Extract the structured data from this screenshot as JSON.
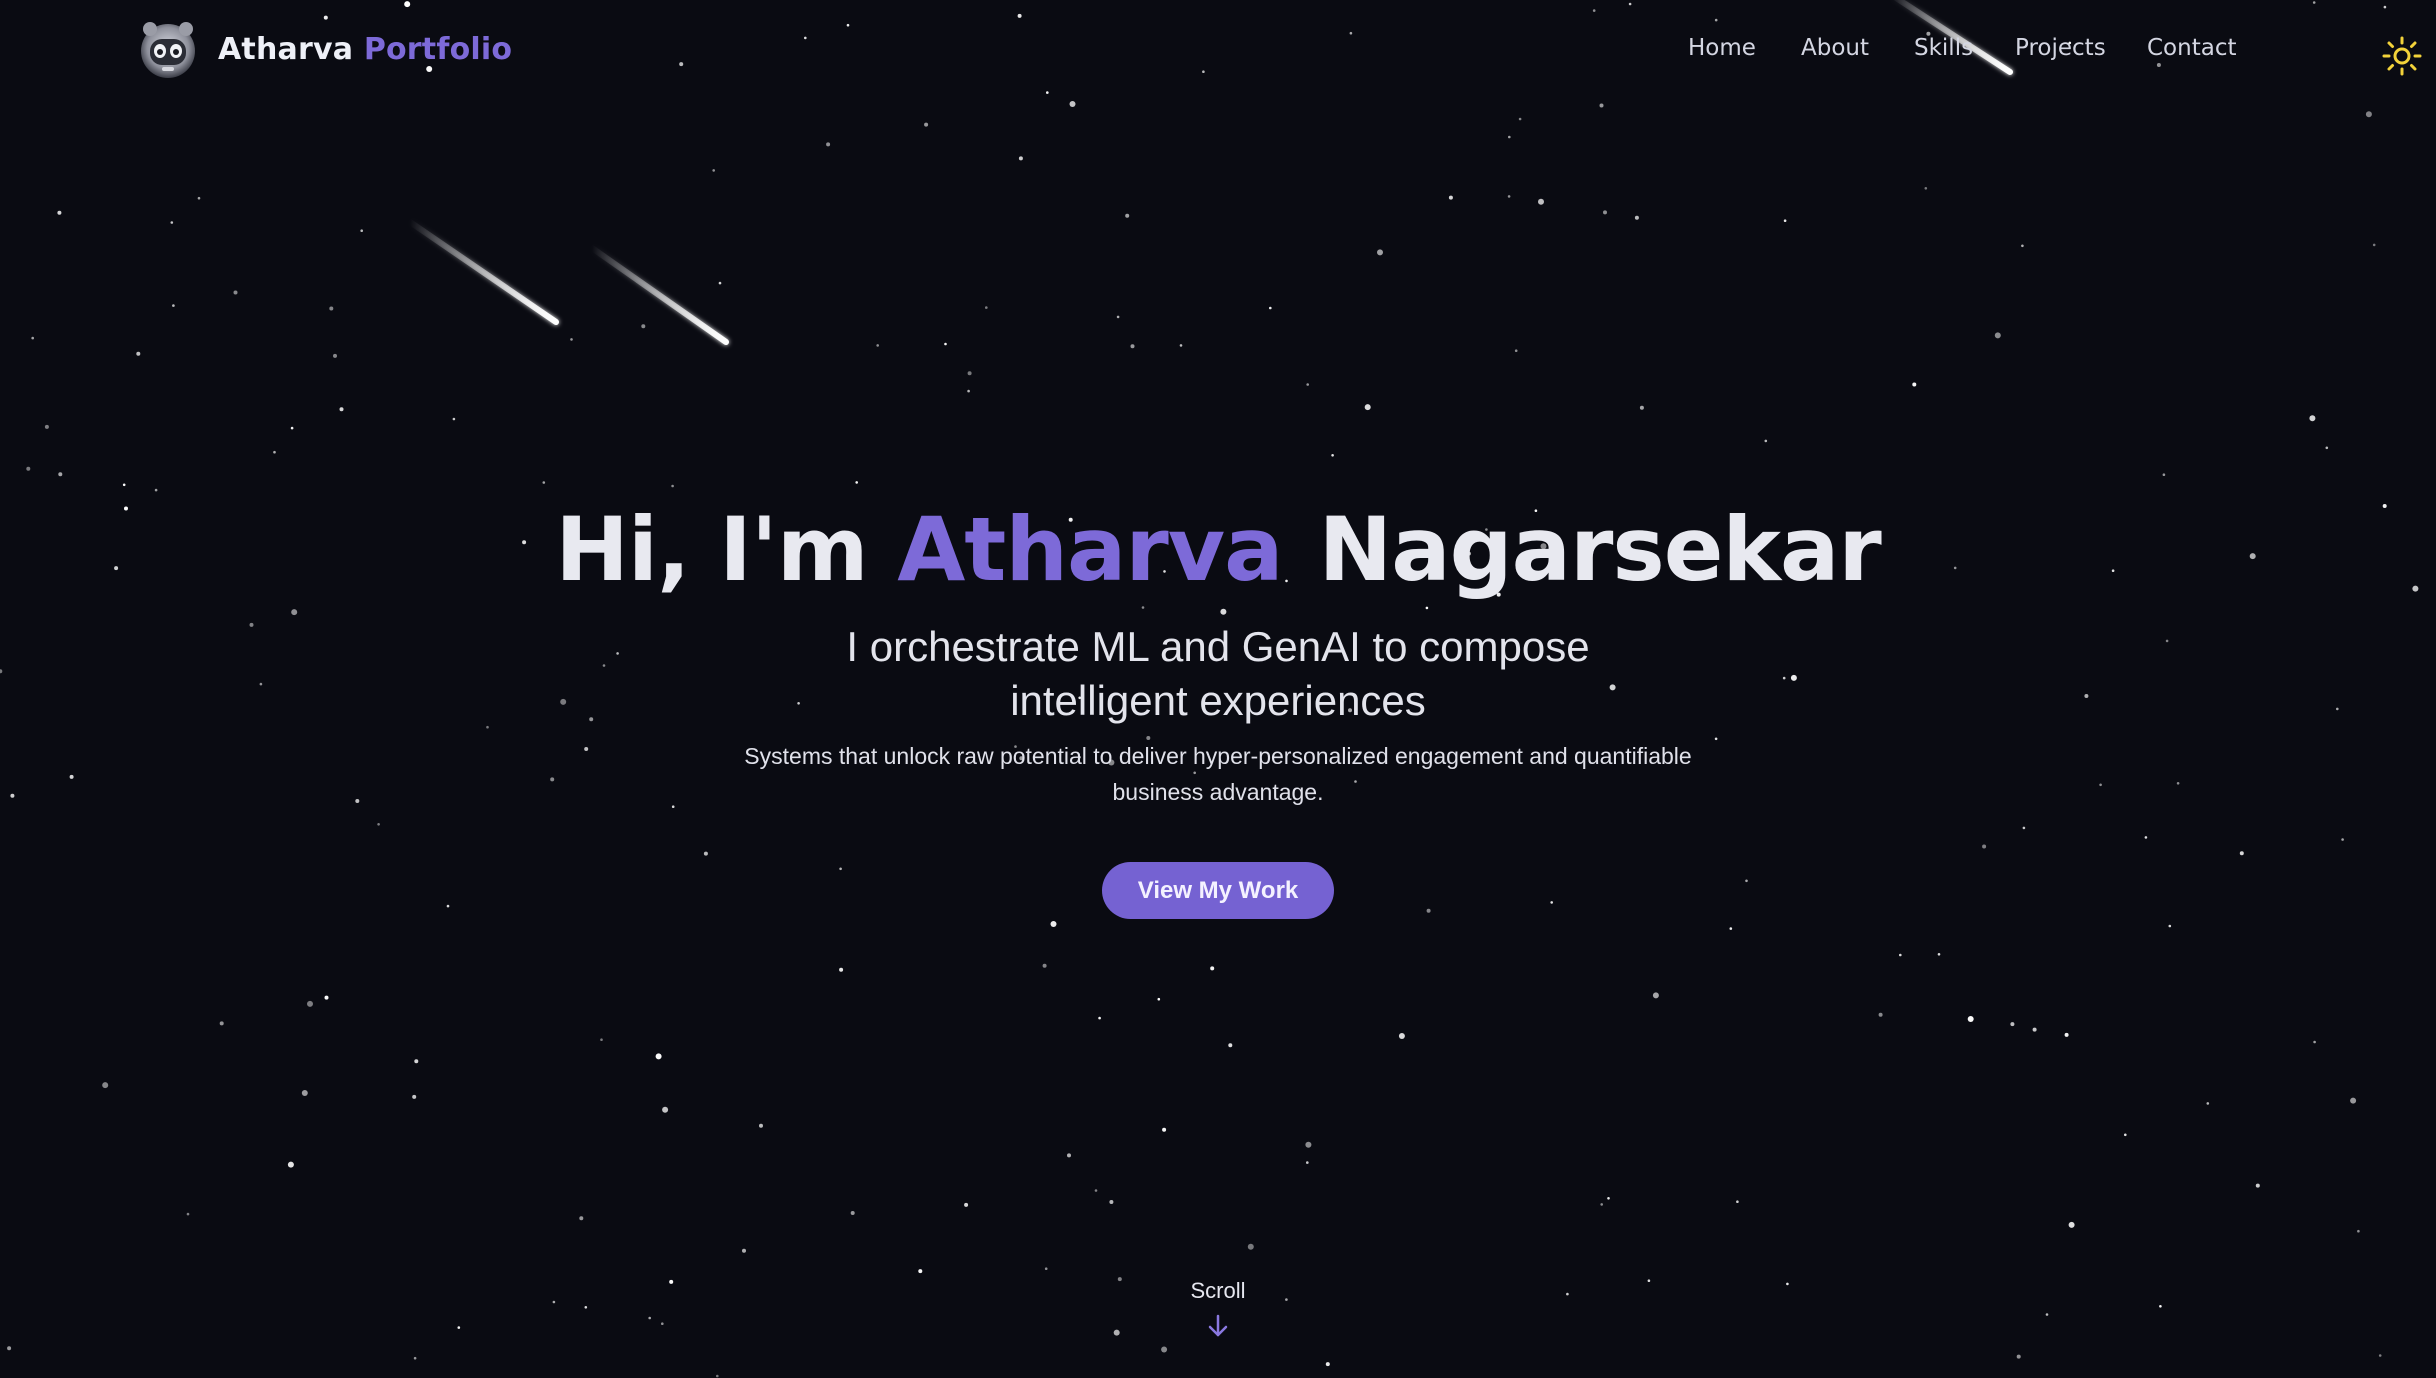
{
  "brand": {
    "name_first": "Atharva",
    "name_second": "Portfolio",
    "logo_icon": "robot-avatar-icon"
  },
  "nav": {
    "items": [
      {
        "label": "Home"
      },
      {
        "label": "About"
      },
      {
        "label": "Skills"
      },
      {
        "label": "Projects"
      },
      {
        "label": "Contact"
      }
    ],
    "theme_toggle_icon": "sun-icon"
  },
  "hero": {
    "greeting": "Hi, I'm",
    "first_name": "Atharva",
    "last_name": "Nagarsekar",
    "subtitle": "I orchestrate ML and GenAI to compose intelligent experiences",
    "description": "Systems that unlock raw potential to deliver hyper-personalized engagement and quantifiable business advantage.",
    "cta_label": "View My Work"
  },
  "scroll": {
    "label": "Scroll",
    "icon": "arrow-down-icon"
  },
  "colors": {
    "background": "#0a0b12",
    "accent": "#7d6ad8",
    "button": "#7562d2",
    "text": "#e8e9f0",
    "sun": "#f2d23a"
  }
}
